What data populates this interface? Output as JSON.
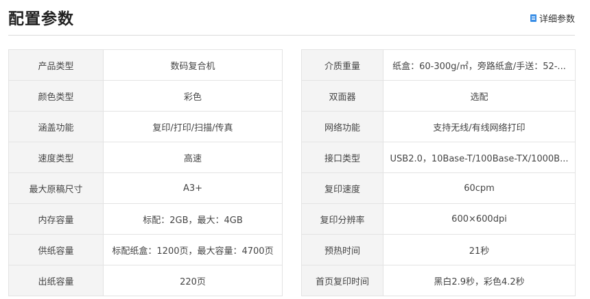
{
  "header": {
    "title": "配置参数",
    "detail_link": "详细参数",
    "detail_icon": "document-icon",
    "icon_color": "#3a8ee6"
  },
  "left_table": [
    {
      "label": "产品类型",
      "value": "数码复合机"
    },
    {
      "label": "颜色类型",
      "value": "彩色"
    },
    {
      "label": "涵盖功能",
      "value": "复印/打印/扫描/传真"
    },
    {
      "label": "速度类型",
      "value": "高速"
    },
    {
      "label": "最大原稿尺寸",
      "value": "A3+"
    },
    {
      "label": "内存容量",
      "value": "标配：2GB，最大：4GB"
    },
    {
      "label": "供纸容量",
      "value": "标配纸盒：1200页，最大容量：4700页"
    },
    {
      "label": "出纸容量",
      "value": "220页"
    }
  ],
  "right_table": [
    {
      "label": "介质重量",
      "value": "纸盒：60-300g/㎡，旁路纸盒/手送：52-..."
    },
    {
      "label": "双面器",
      "value": "选配"
    },
    {
      "label": "网络功能",
      "value": "支持无线/有线网络打印"
    },
    {
      "label": "接口类型",
      "value": "USB2.0，10Base-T/100Base-TX/1000B..."
    },
    {
      "label": "复印速度",
      "value": "60cpm"
    },
    {
      "label": "复印分辨率",
      "value": "600×600dpi"
    },
    {
      "label": "预热时间",
      "value": "21秒"
    },
    {
      "label": "首页复印时间",
      "value": "黑白2.9秒，彩色4.2秒"
    }
  ]
}
